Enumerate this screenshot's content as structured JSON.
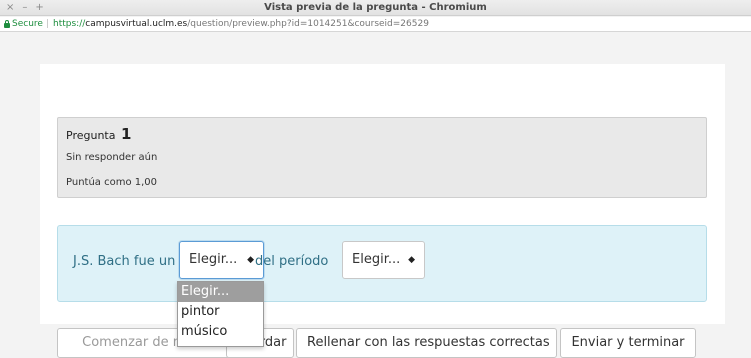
{
  "window": {
    "title": "Vista previa de la pregunta - Chromium",
    "controls": {
      "close": "×",
      "minimize": "–",
      "maximize": "+"
    }
  },
  "address_bar": {
    "secure_label": "Secure",
    "separator": "|",
    "url_scheme": "https://",
    "url_host": "campusvirtual.uclm.es",
    "url_path": "/question/preview.php?id=1014251&courseid=26529"
  },
  "question_info": {
    "label": "Pregunta",
    "number": "1",
    "state": "Sin responder aún",
    "mark": "Puntúa como 1,00"
  },
  "question": {
    "text_before": "J.S. Bach fue un",
    "text_middle": "del período",
    "select1_value": "Elegir...",
    "select2_value": "Elegir...",
    "select_arrow": "◆"
  },
  "dropdown": {
    "options": [
      "Elegir...",
      "pintor",
      "músico"
    ],
    "highlighted": "Elegir..."
  },
  "buttons": {
    "start_again": "Comenzar de nuevo",
    "save": "Guardar",
    "fill_correct": "Rellenar con las respuestas correctas",
    "submit": "Enviar y terminar"
  },
  "colors": {
    "secure_green": "#1e8e3e",
    "question_bg": "#def2f8",
    "question_text": "#2f6f85",
    "info_bg": "#e9e9e9"
  }
}
